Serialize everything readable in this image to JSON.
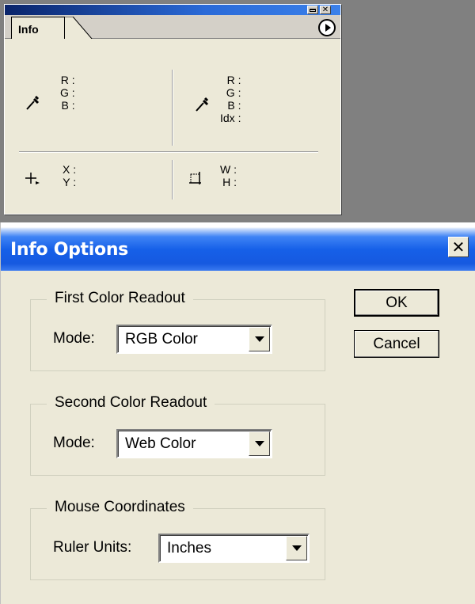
{
  "info_palette": {
    "tab_label": "Info",
    "first_color_labels": [
      "R :",
      "G :",
      "B :"
    ],
    "second_color_labels": [
      "R :",
      "G :",
      "B :",
      "Idx :"
    ],
    "coordinate_labels": [
      "X :",
      "Y :"
    ],
    "size_labels": [
      "W :",
      "H :"
    ],
    "icons": {
      "eyedropper_1": "eyedropper-icon",
      "eyedropper_2": "eyedropper-icon",
      "crosshair": "crosshair-icon",
      "selection": "selection-size-icon",
      "menu": "palette-menu-icon"
    }
  },
  "dialog": {
    "title": "Info Options",
    "ok_label": "OK",
    "cancel_label": "Cancel",
    "first_color": {
      "legend": "First Color Readout",
      "mode_label": "Mode:",
      "mode_value": "RGB Color"
    },
    "second_color": {
      "legend": "Second Color Readout",
      "mode_label": "Mode:",
      "mode_value": "Web Color"
    },
    "mouse_coordinates": {
      "legend": "Mouse Coordinates",
      "units_label": "Ruler Units:",
      "units_value": "Inches"
    }
  },
  "colors": {
    "titlebar_blue": "#1660e8",
    "panel_face": "#ece9d8",
    "desktop_gray": "#808080"
  }
}
